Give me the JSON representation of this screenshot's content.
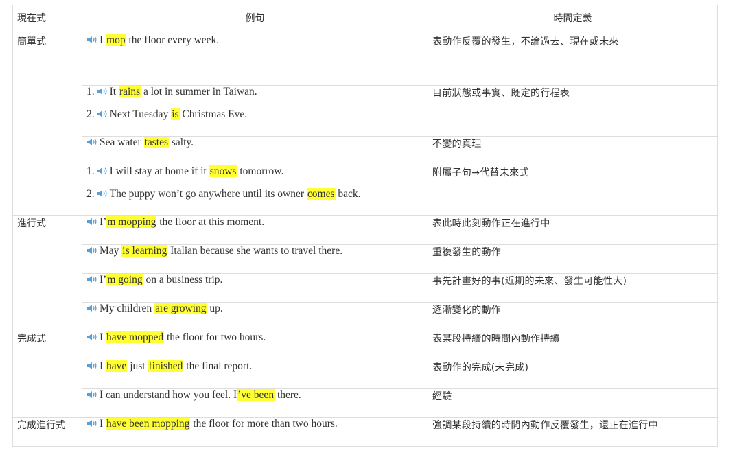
{
  "headers": {
    "tense": "現在式",
    "example": "例句",
    "definition": "時間定義"
  },
  "colors": {
    "highlight": "#ffff33",
    "speaker": "#5aa0d8",
    "border": "#dddddd"
  },
  "groups": [
    {
      "name": "簡單式",
      "rows": [
        {
          "lines": [
            {
              "num": "",
              "parts": [
                "I ",
                "mop",
                " the floor every week."
              ]
            }
          ],
          "definition": "表動作反覆的發生，不論過去、現在或未來"
        },
        {
          "lines": [
            {
              "num": "1.",
              "parts": [
                "It ",
                "rains",
                " a lot in summer in Taiwan."
              ]
            },
            {
              "num": "2.",
              "parts": [
                "Next Tuesday ",
                "is",
                " Christmas Eve."
              ]
            }
          ],
          "definition": "目前狀態或事實、既定的行程表"
        },
        {
          "lines": [
            {
              "num": "",
              "parts": [
                "Sea water ",
                "tastes",
                " salty."
              ]
            }
          ],
          "definition": "不變的真理"
        },
        {
          "lines": [
            {
              "num": "1.",
              "parts": [
                "I will stay at home if it ",
                "snows",
                " tomorrow."
              ]
            },
            {
              "num": "2.",
              "parts": [
                "The puppy won’t go anywhere until its owner ",
                "comes",
                " back."
              ]
            }
          ],
          "definition": "附屬子句→代替未來式"
        }
      ]
    },
    {
      "name": "進行式",
      "rows": [
        {
          "lines": [
            {
              "num": "",
              "parts": [
                "I’",
                "m mopping",
                " the floor at this moment."
              ]
            }
          ],
          "definition": "表此時此刻動作正在進行中"
        },
        {
          "lines": [
            {
              "num": "",
              "parts": [
                "May ",
                "is learning",
                " Italian because she wants to travel there."
              ]
            }
          ],
          "definition": "重複發生的動作"
        },
        {
          "lines": [
            {
              "num": "",
              "parts": [
                "I’",
                "m going",
                " on a business trip."
              ]
            }
          ],
          "definition": "事先計畫好的事(近期的未來、發生可能性大)"
        },
        {
          "lines": [
            {
              "num": "",
              "parts": [
                "My children ",
                "are growing",
                " up."
              ]
            }
          ],
          "definition": "逐漸變化的動作"
        }
      ]
    },
    {
      "name": "完成式",
      "rows": [
        {
          "lines": [
            {
              "num": "",
              "parts": [
                "I ",
                "have mopped",
                " the floor for two hours."
              ]
            }
          ],
          "definition": "表某段持續的時間內動作持續"
        },
        {
          "lines": [
            {
              "num": "",
              "parts": [
                "I ",
                "have",
                " just ",
                "finished",
                " the final report."
              ]
            }
          ],
          "definition": "表動作的完成(未完成)"
        },
        {
          "lines": [
            {
              "num": "",
              "parts": [
                "I can understand how you feel. I",
                "’ve been",
                " there."
              ]
            }
          ],
          "definition": "經驗"
        }
      ]
    },
    {
      "name": "完成進行式",
      "rows": [
        {
          "lines": [
            {
              "num": "",
              "parts": [
                "I ",
                "have been mopping",
                " the floor for more than two hours."
              ]
            }
          ],
          "definition": "強調某段持續的時間內動作反覆發生，還正在進行中"
        }
      ]
    }
  ]
}
